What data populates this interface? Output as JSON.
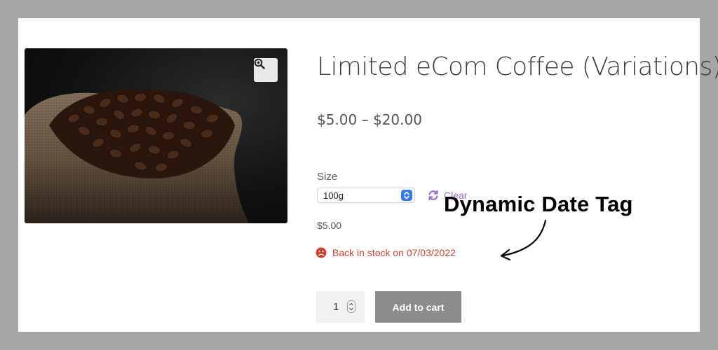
{
  "product": {
    "title": "Limited eCom Coffee (Variations)",
    "price_range": "$5.00 – $20.00",
    "image_icon": "coffee-beans-sack-photo"
  },
  "zoom": {
    "icon": "zoom-in-icon"
  },
  "variation": {
    "label": "Size",
    "selected": "100g",
    "clear_label": "Clear",
    "price": "$5.00"
  },
  "stock": {
    "icon": "sad-face-icon",
    "text": "Back in stock on 07/03/2022",
    "color": "#d0402f"
  },
  "annotation": {
    "text": "Dynamic Date Tag"
  },
  "cart": {
    "quantity": "1",
    "button_label": "Add to cart"
  },
  "colors": {
    "accent_purple": "#9b6fc4",
    "button_gray": "#8c8c8c",
    "frame_gray": "#a6a6a6"
  }
}
